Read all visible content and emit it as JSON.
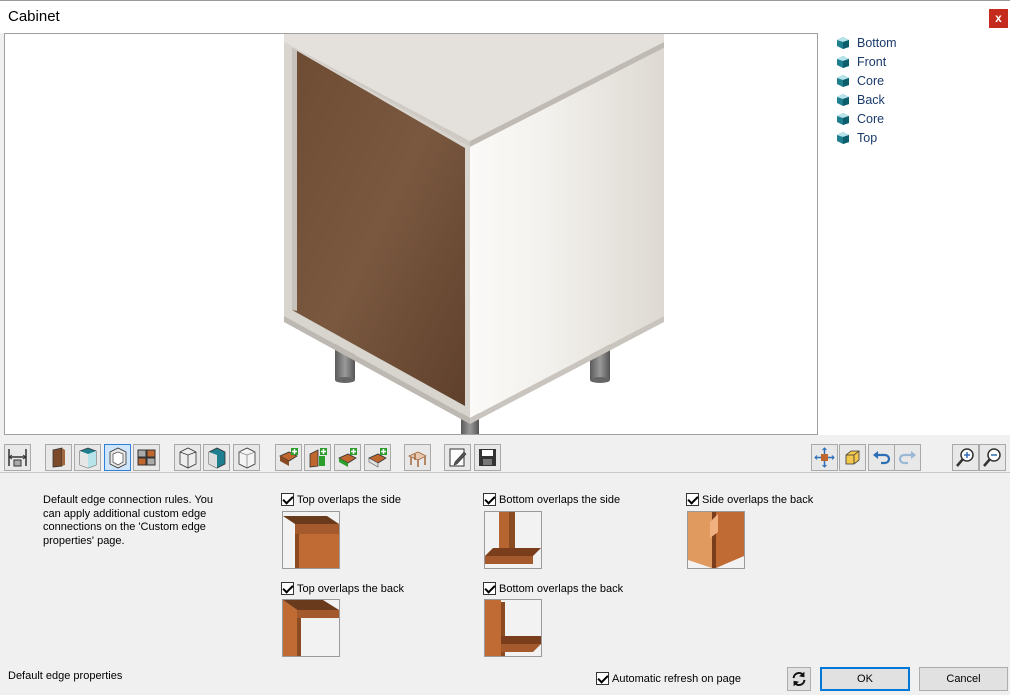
{
  "window": {
    "title": "Cabinet",
    "close_label": "x"
  },
  "tree": {
    "items": [
      {
        "label": "Bottom"
      },
      {
        "label": "Front"
      },
      {
        "label": "Core"
      },
      {
        "label": "Back"
      },
      {
        "label": "Core"
      },
      {
        "label": "Top"
      }
    ]
  },
  "settings": {
    "description": "Default edge connection rules. You can apply additional custom edge connections on the 'Custom edge properties' page.",
    "options": [
      {
        "label": "Top overlaps the side",
        "checked": true
      },
      {
        "label": "Bottom overlaps the side",
        "checked": true
      },
      {
        "label": "Side overlaps the back",
        "checked": true
      },
      {
        "label": "Top overlaps the back",
        "checked": true
      },
      {
        "label": "Bottom overlaps the back",
        "checked": true
      }
    ]
  },
  "footer": {
    "section_label": "Default edge properties",
    "auto_refresh_label": "Automatic refresh on page",
    "auto_refresh_checked": true,
    "ok_label": "OK",
    "cancel_label": "Cancel"
  },
  "colors": {
    "wood": "#6b4a33",
    "panel": "#e9e6e0",
    "accent": "#0078d7",
    "tree_text": "#1a3a6a"
  },
  "icons": {
    "close": "close-icon",
    "refresh": "refresh-icon",
    "tree_item": "cube-icon"
  }
}
